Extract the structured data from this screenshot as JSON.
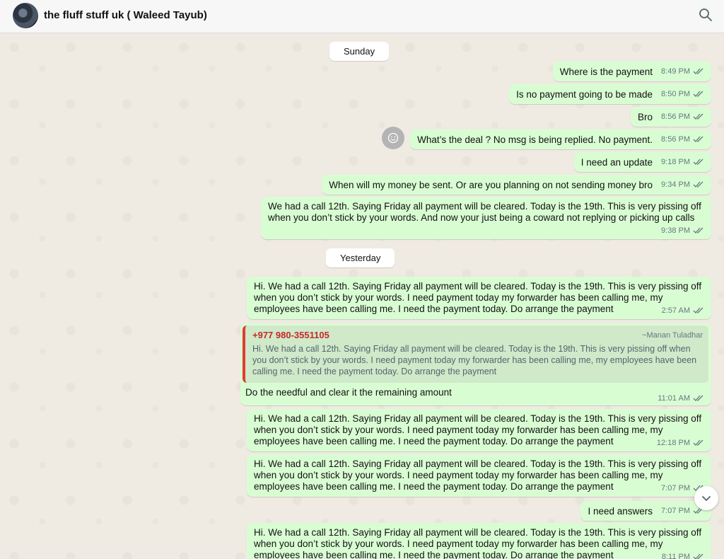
{
  "header": {
    "title": "the fluff stuff uk ( Waleed Tayub)"
  },
  "date_sunday": "Sunday",
  "date_yesterday": "Yesterday",
  "messages": [
    {
      "text": "Where is the payment",
      "time": "8:49 PM"
    },
    {
      "text": "Is no payment going to be made",
      "time": "8:50 PM"
    },
    {
      "text": "Bro",
      "time": "8:56 PM"
    },
    {
      "text": "What’s the deal ? No msg is being replied. No payment.",
      "time": "8:56 PM"
    },
    {
      "text": "I need an update",
      "time": "9:18 PM"
    },
    {
      "text": "When will my money be sent. Or are you planning on not sending money bro",
      "time": "9:34 PM"
    },
    {
      "text": "We had a call 12th. Saying Friday all payment will be cleared. Today is the 19th. This is very pissing off when you don’t stick by your words. And now your just being a coward not replying or picking up calls",
      "time": "9:38 PM"
    },
    {
      "text": "Hi. We had a call 12th. Saying Friday all payment will be cleared. Today is the 19th. This is very pissing off when you don’t stick by your words. I need payment today my forwarder has been calling me, my employees have been calling me. I need the payment today. Do arrange the payment",
      "time": "2:57 AM"
    },
    {
      "text": "Do the needful and clear it the remaining amount",
      "time": "11:01 AM"
    },
    {
      "text": "Hi. We had a call 12th. Saying Friday all payment will be cleared. Today is the 19th. This is very pissing off when you don’t stick by your words. I need payment today my forwarder has been calling me, my employees have been calling me. I need the payment today. Do arrange the payment",
      "time": "12:18 PM"
    },
    {
      "text": "Hi. We had a call 12th. Saying Friday all payment will be cleared. Today is the 19th. This is very pissing off when you don’t stick by your words. I need payment today my forwarder has been calling me, my employees have been calling me. I need the payment today. Do arrange the payment",
      "time": "7:07 PM"
    },
    {
      "text": "I need answers",
      "time": "7:07 PM"
    },
    {
      "text": "Hi. We had a call 12th. Saying Friday all payment will be cleared. Today is the 19th. This is very pissing off when you don’t stick by your words. I need payment today my forwarder has been calling me, my employees have been calling me. I need the payment today. Do arrange the payment",
      "time": "8:11 PM"
    }
  ],
  "quote": {
    "phone": "+977 980-3551105",
    "author": "~Manan Tuladhar",
    "text": "Hi. We had a call 12th. Saying Friday all payment will be cleared. Today is the 19th. This is very pissing off when you don’t stick by your words. I need payment today my forwarder has been calling me, my employees have been calling me. I need the payment today. Do arrange the payment"
  },
  "icons": {
    "search": "search-icon",
    "reaction": "emoji-icon",
    "ticks": "double-check-icon",
    "scroll": "chevron-down-icon"
  },
  "colors": {
    "outgoing_bubble": "#d9fdd3",
    "quote_bar": "#e53935",
    "quote_phone": "#c62828",
    "background": "#efeae2"
  }
}
